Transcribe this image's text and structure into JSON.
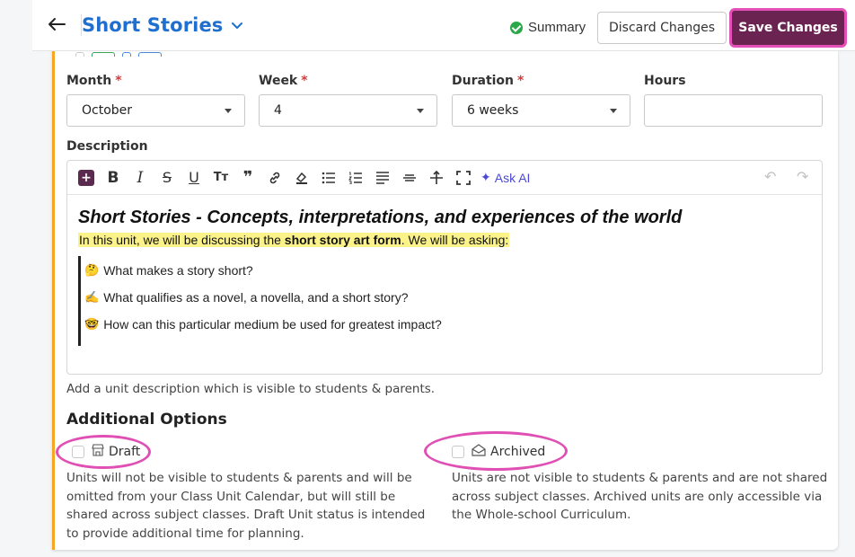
{
  "header": {
    "title": "Short Stories",
    "summary_label": "Summary",
    "discard_label": "Discard Changes",
    "save_label": "Save Changes"
  },
  "fields": {
    "month": {
      "label": "Month",
      "value": "October"
    },
    "week": {
      "label": "Week",
      "value": "4"
    },
    "duration": {
      "label": "Duration",
      "value": "6 weeks"
    },
    "hours": {
      "label": "Hours",
      "value": ""
    },
    "required_mark": "*"
  },
  "description": {
    "label": "Description",
    "ask_ai": "Ask AI",
    "heading": "Short Stories - Concepts, interpretations, and experiences of the world",
    "intro_prefix": "In this unit, we will be discussing the ",
    "intro_bold": "short story art form",
    "intro_suffix": ". We will be asking:",
    "questions": [
      {
        "emoji": "🤔",
        "text": "What makes a story short?"
      },
      {
        "emoji": "✍️",
        "text": "What qualifies as a novel, a novella, and a short story?"
      },
      {
        "emoji": "🤓",
        "text": "How can this particular medium be used for greatest impact?"
      }
    ],
    "helper": "Add a unit description which is visible to students & parents."
  },
  "options": {
    "title": "Additional Options",
    "draft": {
      "label": "Draft",
      "desc": "Units will not be visible to students & parents and will be omitted from your Class Unit Calendar, but will still be shared across subject classes. Draft Unit status is intended to provide additional time for planning."
    },
    "archived": {
      "label": "Archived",
      "desc": "Units are not visible to students & parents and are not shared across subject classes. Archived units are only accessible via the Whole-school Curriculum."
    }
  },
  "colors": {
    "accent_blue": "#1f6fd1",
    "save_bg": "#6b2352",
    "highlight_ring": "#e04fb3",
    "card_border": "#f5a623",
    "text_highlight": "#fbf38a"
  }
}
